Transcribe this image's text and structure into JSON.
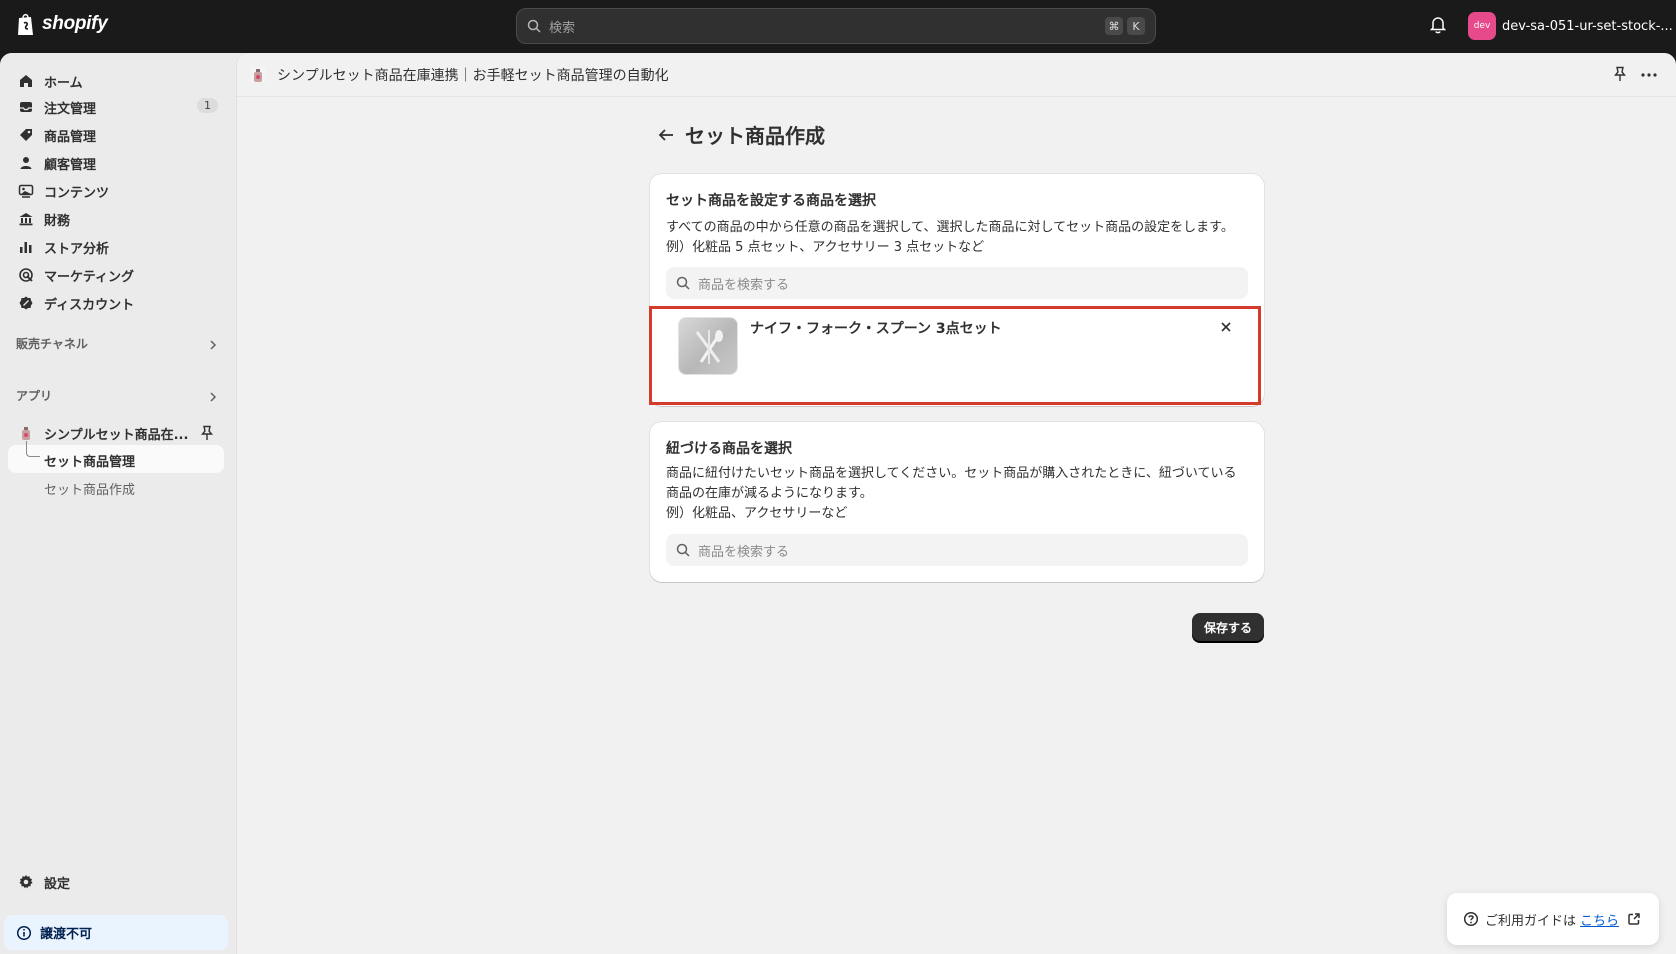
{
  "topbar": {
    "logo_text": "shopify",
    "search_placeholder": "検索",
    "shortcut_key1": "⌘",
    "shortcut_key2": "K",
    "store_avatar": "dev",
    "store_name": "dev-sa-051-ur-set-stock-..."
  },
  "sidebar": {
    "items": [
      {
        "label": "ホーム",
        "icon": "home-icon"
      },
      {
        "label": "注文管理",
        "icon": "inbox-icon",
        "badge": "1"
      },
      {
        "label": "商品管理",
        "icon": "tag-icon"
      },
      {
        "label": "顧客管理",
        "icon": "person-icon"
      },
      {
        "label": "コンテンツ",
        "icon": "image-icon"
      },
      {
        "label": "財務",
        "icon": "bank-icon"
      },
      {
        "label": "ストア分析",
        "icon": "chart-icon"
      },
      {
        "label": "マーケティング",
        "icon": "target-icon"
      },
      {
        "label": "ディスカウント",
        "icon": "discount-icon"
      }
    ],
    "sales_channels_label": "販売チャネル",
    "apps_label": "アプリ",
    "app_name": "シンプルセット商品在...",
    "app_sub_active": "セット商品管理",
    "app_sub_item": "セット商品作成",
    "settings_label": "設定",
    "transfer_label": "譲渡不可"
  },
  "app_header": {
    "title": "シンプルセット商品在庫連携｜お手軽セット商品管理の自動化"
  },
  "page": {
    "title": "セット商品作成",
    "card1": {
      "title": "セット商品を設定する商品を選択",
      "text_line1": "すべての商品の中から任意の商品を選択して、選択した商品に対してセット商品の設定をします。",
      "text_line2": "例）化粧品 5 点セット、アクセサリー 3 点セットなど",
      "search_placeholder": "商品を検索する",
      "selected_product": "ナイフ・フォーク・スプーン 3点セット"
    },
    "card2": {
      "title": "紐づける商品を選択",
      "text_line1": "商品に紐付けたいセット商品を選択してください。セット商品が購入されたときに、紐づいている",
      "text_line2": "商品の在庫が減るようになります。",
      "text_line3": "例）化粧品、アクセサリーなど",
      "search_placeholder": "商品を検索する"
    },
    "save_label": "保存する"
  },
  "guide": {
    "label": "ご利用ガイドは",
    "link": "こちら"
  },
  "colors": {
    "highlight": "#d63a2a",
    "link": "#005bd3",
    "avatar": "#e64a8a"
  }
}
